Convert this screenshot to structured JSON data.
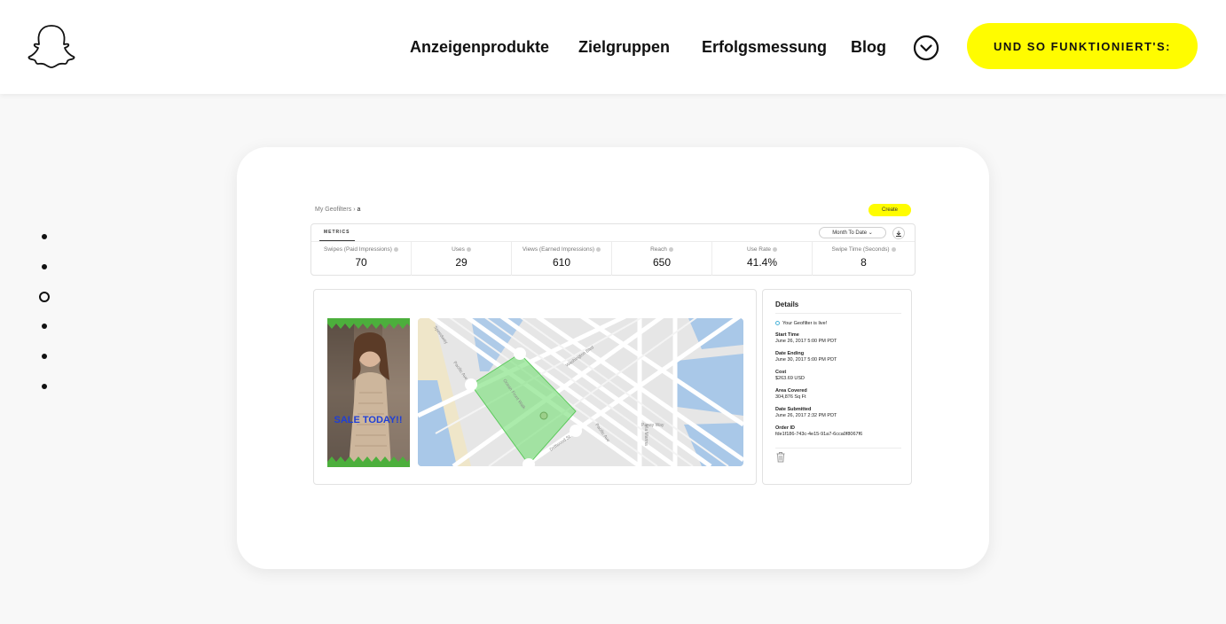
{
  "header": {
    "nav": [
      {
        "label": "Anzeigenprodukte"
      },
      {
        "label": "Zielgruppen"
      },
      {
        "label": "Erfolgsmessung"
      },
      {
        "label": "Blog"
      }
    ],
    "cta_label": "UND SO FUNKTIONIERT'S:",
    "cta_color": "#fffc00"
  },
  "slider": {
    "dot_count": 6,
    "active_index": 2
  },
  "dashboard": {
    "breadcrumb_root": "My Geofilters",
    "breadcrumb_sep": "›",
    "breadcrumb_current": "a",
    "create_label": "Create",
    "metrics_tab": "METRICS",
    "date_range": "Month To Date",
    "metrics": [
      {
        "label": "Swipes (Paid Impressions)",
        "value": "70"
      },
      {
        "label": "Uses",
        "value": "29"
      },
      {
        "label": "Views (Earned Impressions)",
        "value": "610"
      },
      {
        "label": "Reach",
        "value": "650"
      },
      {
        "label": "Use Rate",
        "value": "41.4%"
      },
      {
        "label": "Swipe Time (Seconds)",
        "value": "8"
      }
    ],
    "geofilter_text": "SALE TODAY!!",
    "map_labels": {
      "street_a": "Pacific Ave",
      "street_b": "Via Marina",
      "street_c": "Panay Way",
      "street_d": "Washington Blvd",
      "street_e": "Speedway",
      "street_f": "Ocean Front Walk",
      "street_g": "Pacific Ave",
      "street_h": "Driftwood St"
    },
    "details": {
      "title": "Details",
      "status": "Your Geofilter is live!",
      "fields": [
        {
          "key": "Start Time",
          "value": "June 26, 2017 5:00 PM  PDT"
        },
        {
          "key": "Date Ending",
          "value": "June 30, 2017 5:00 PM  PDT"
        },
        {
          "key": "Cost",
          "value": "$263.69 USD"
        },
        {
          "key": "Area Covered",
          "value": "304,876 Sq Ft"
        },
        {
          "key": "Date Submitted",
          "value": "June 26, 2017 2:32 PM  PDT"
        },
        {
          "key": "Order ID",
          "value": "fde1f186-743c-4e15-91a7-6cca0f8067f6"
        }
      ]
    }
  }
}
